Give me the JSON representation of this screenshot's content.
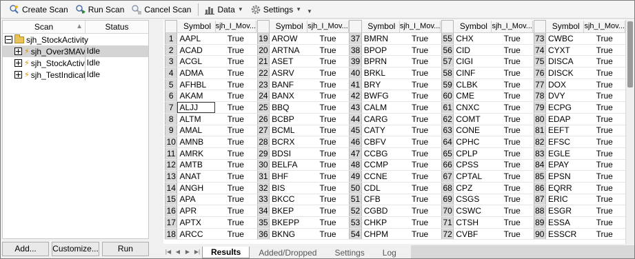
{
  "toolbar": {
    "create_scan": "Create Scan",
    "run_scan": "Run Scan",
    "cancel_scan": "Cancel Scan",
    "data": "Data",
    "settings": "Settings"
  },
  "tree": {
    "col_scan": "Scan",
    "col_status": "Status",
    "root": "sjh_StockActivity",
    "items": [
      {
        "name": "sjh_Over3MAVol",
        "status": "Idle"
      },
      {
        "name": "sjh_StockActivity",
        "status": "Idle"
      },
      {
        "name": "sjh_TestIndicator",
        "status": "Idle"
      }
    ]
  },
  "left_buttons": {
    "add": "Add...",
    "customize": "Customize...",
    "run": "Run"
  },
  "grid": {
    "col_symbol": "Symbol",
    "col_value": "sjh_I_Mov...",
    "value": "True",
    "columns": [
      {
        "start": 1,
        "symbols": [
          "AAPL",
          "ACAD",
          "ACGL",
          "ADMA",
          "AFHBL",
          "AKAM",
          "ALJJ",
          "ALTM",
          "AMAL",
          "AMNB",
          "AMRK",
          "AMTB",
          "ANAT",
          "ANGH",
          "APA",
          "APR",
          "APTX",
          "ARCC"
        ]
      },
      {
        "start": 19,
        "symbols": [
          "AROW",
          "ARTNA",
          "ASET",
          "ASRV",
          "BANF",
          "BANX",
          "BBQ",
          "BCBP",
          "BCML",
          "BCRX",
          "BDSI",
          "BELFA",
          "BHF",
          "BIS",
          "BKCC",
          "BKEP",
          "BKEPP",
          "BKNG"
        ]
      },
      {
        "start": 37,
        "symbols": [
          "BMRN",
          "BPOP",
          "BPRN",
          "BRKL",
          "BRY",
          "BWFG",
          "CALM",
          "CARG",
          "CATY",
          "CBFV",
          "CCBG",
          "CCMP",
          "CCNE",
          "CDL",
          "CFB",
          "CGBD",
          "CHKP",
          "CHPM"
        ]
      },
      {
        "start": 55,
        "symbols": [
          "CHX",
          "CID",
          "CIGI",
          "CINF",
          "CLBK",
          "CME",
          "CNXC",
          "COMT",
          "CONE",
          "CPHC",
          "CPLP",
          "CPSS",
          "CPTAL",
          "CPZ",
          "CSGS",
          "CSWC",
          "CTSH",
          "CVBF"
        ]
      },
      {
        "start": 73,
        "symbols": [
          "CWBC",
          "CYXT",
          "DISCA",
          "DISCK",
          "DOX",
          "DVY",
          "ECPG",
          "EDAP",
          "EEFT",
          "EFSC",
          "EGLE",
          "EPAY",
          "EPSN",
          "EQRR",
          "ERIC",
          "ESGR",
          "ESSA",
          "ESSCR"
        ]
      }
    ]
  },
  "tabs": [
    "Results",
    "Added/Dropped",
    "Settings",
    "Log"
  ],
  "colors": {
    "accent_bolt": "#e08a00",
    "row_selected": "#d4d4d4",
    "row_number_bg": "#d9d9d9"
  }
}
